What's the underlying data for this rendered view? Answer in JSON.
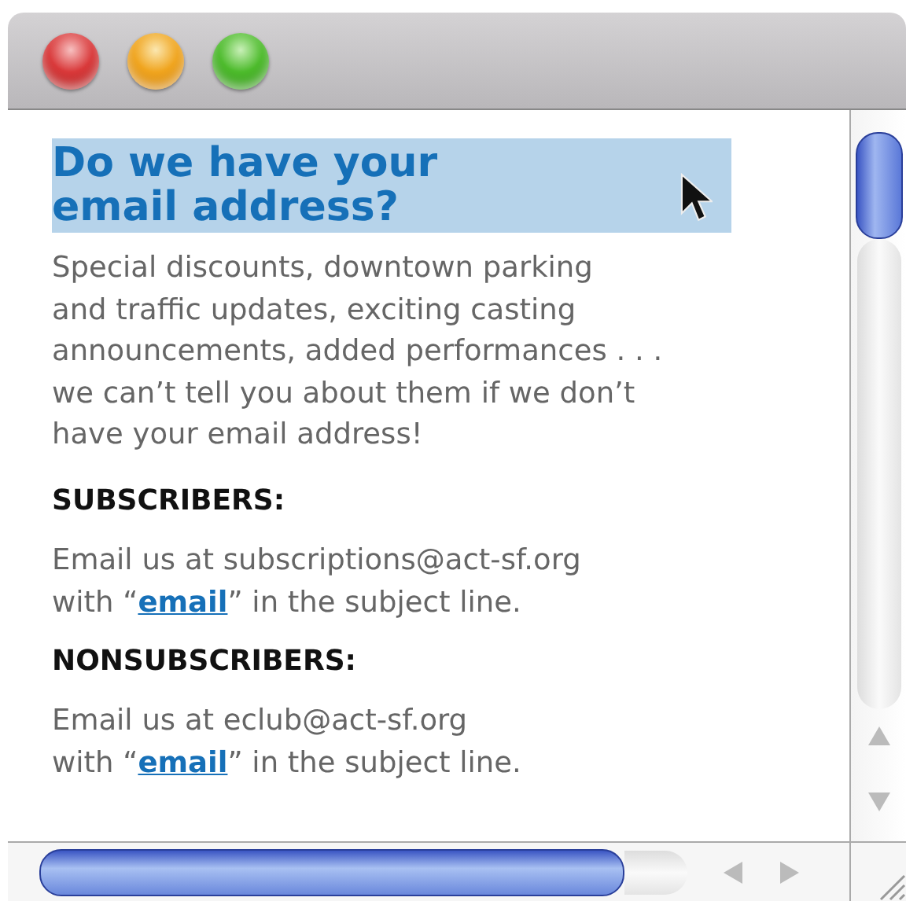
{
  "heading": {
    "lines": [
      "Do we have your",
      "email address?"
    ],
    "selected": true
  },
  "intro": [
    "Special discounts, downtown parking",
    "and traffic updates, exciting casting",
    "announcements, added performances . . .",
    "we can’t tell you about them if we don’t",
    "have your email address!"
  ],
  "sections": [
    {
      "title": "SUBSCRIBERS:",
      "line1": "Email us at subscriptions@act-sf.org",
      "before": "with “",
      "link": "email",
      "after": "” in the subject line."
    },
    {
      "title": "NONSUBSCRIBERS:",
      "line1": "Email us at eclub@act-sf.org",
      "before": "with “",
      "link": "email",
      "after": "” in the subject line."
    }
  ]
}
